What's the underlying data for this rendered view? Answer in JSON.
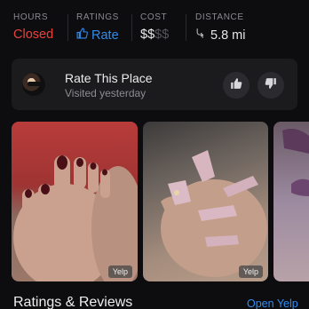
{
  "stats": {
    "hours": {
      "label": "HOURS",
      "value": "Closed"
    },
    "ratings": {
      "label": "RATINGS",
      "value": "Rate",
      "icon": "thumbs-up-icon"
    },
    "cost": {
      "label": "COST",
      "active": "$$",
      "inactive": "$$"
    },
    "distance": {
      "label": "DISTANCE",
      "value": "5.8 mi",
      "icon": "directions-arrow-icon"
    }
  },
  "rate_card": {
    "title": "Rate This Place",
    "subtitle": "Visited yesterday"
  },
  "photos": [
    {
      "subject": "toenails with dark red polish",
      "tag": "Yelp"
    },
    {
      "subject": "fingernails with pink glitter polish",
      "tag": "Yelp"
    },
    {
      "subject": "nails with purple polish",
      "tag": ""
    }
  ],
  "reviews": {
    "title": "Ratings & Reviews",
    "link": "Open Yelp"
  },
  "colors": {
    "background": "#0d0d0f",
    "closed": "#e8423a",
    "accent": "#2f8cf0",
    "card": "#1b1b1e"
  }
}
